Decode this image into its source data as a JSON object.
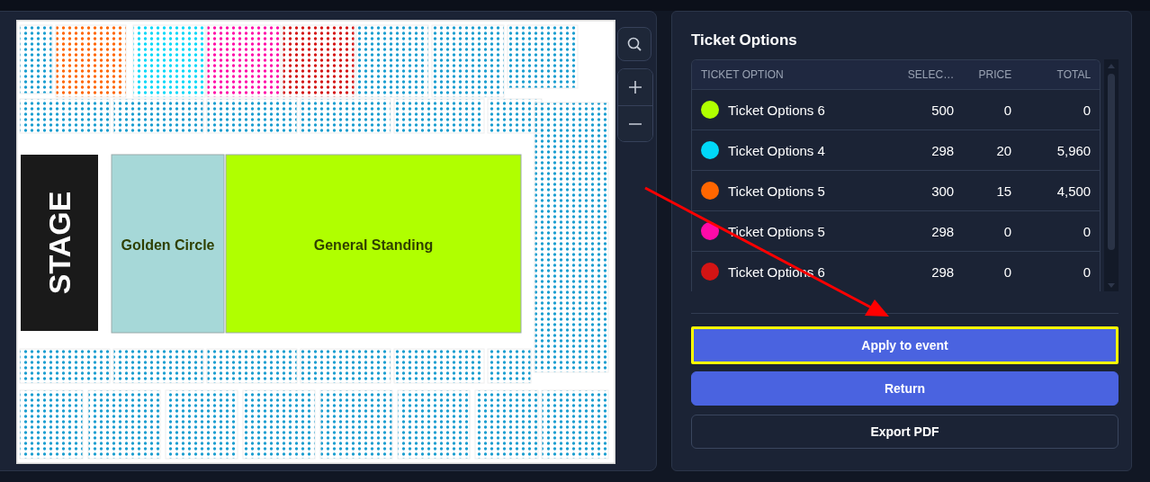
{
  "seat_map": {
    "stage": "STAGE",
    "areas": [
      {
        "label": "Golden Circle",
        "color": "#a6d8d8"
      },
      {
        "label": "General Standing",
        "color": "#b0ff00"
      }
    ]
  },
  "ticket_options": {
    "title": "Ticket Options",
    "columns": [
      "TICKET OPTION",
      "SELEC…",
      "PRICE",
      "TOTAL"
    ],
    "rows": [
      {
        "name": "Ticket Options 6",
        "color": "#b0ff00",
        "selected": "500",
        "price": "0",
        "total": "0"
      },
      {
        "name": "Ticket Options 4",
        "color": "#00d8f8",
        "selected": "298",
        "price": "20",
        "total": "5,960"
      },
      {
        "name": "Ticket Options 5",
        "color": "#ff6600",
        "selected": "300",
        "price": "15",
        "total": "4,500"
      },
      {
        "name": "Ticket Options 5",
        "color": "#ff0aa8",
        "selected": "298",
        "price": "0",
        "total": "0"
      },
      {
        "name": "Ticket Options 6",
        "color": "#d41414",
        "selected": "298",
        "price": "0",
        "total": "0"
      }
    ]
  },
  "buttons": [
    {
      "label": "Apply to event",
      "kind": "primary",
      "highlighted": true
    },
    {
      "label": "Return",
      "kind": "primary",
      "highlighted": false
    },
    {
      "label": "Export PDF",
      "kind": "outline",
      "highlighted": false
    }
  ]
}
